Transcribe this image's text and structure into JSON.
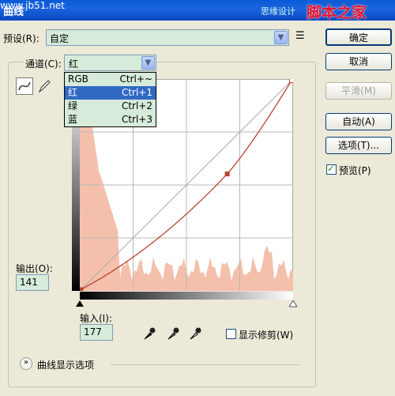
{
  "title": "曲线",
  "watermark": {
    "text": "思缘设计",
    "brand": "脚本之家",
    "url": "www.jb51.net"
  },
  "preset": {
    "label": "预设(R):",
    "value": "自定"
  },
  "channel": {
    "label": "通道(C):",
    "value": "红"
  },
  "channel_menu": [
    {
      "name": "RGB",
      "shortcut": "Ctrl+~"
    },
    {
      "name": "红",
      "shortcut": "Ctrl+1"
    },
    {
      "name": "绿",
      "shortcut": "Ctrl+2"
    },
    {
      "name": "蓝",
      "shortcut": "Ctrl+3"
    }
  ],
  "selected_channel_index": 1,
  "buttons": {
    "ok": "确定",
    "cancel": "取消",
    "smooth": "平滑(M)",
    "auto": "自动(A)",
    "options": "选项(T)...",
    "preview": "预览(P)"
  },
  "output": {
    "label": "输出(O):",
    "value": "141"
  },
  "input": {
    "label": "输入(I):",
    "value": "177"
  },
  "show_clipping": "显示修剪(W)",
  "curve_display_options": "曲线显示选项",
  "curve_points": [
    [
      0,
      0
    ],
    [
      177,
      141
    ],
    [
      255,
      255
    ]
  ],
  "colors": {
    "histogram": "#f4c0ac",
    "curve": "#c0392b",
    "accent": "#316ac5",
    "field": "#d6ebd9"
  }
}
